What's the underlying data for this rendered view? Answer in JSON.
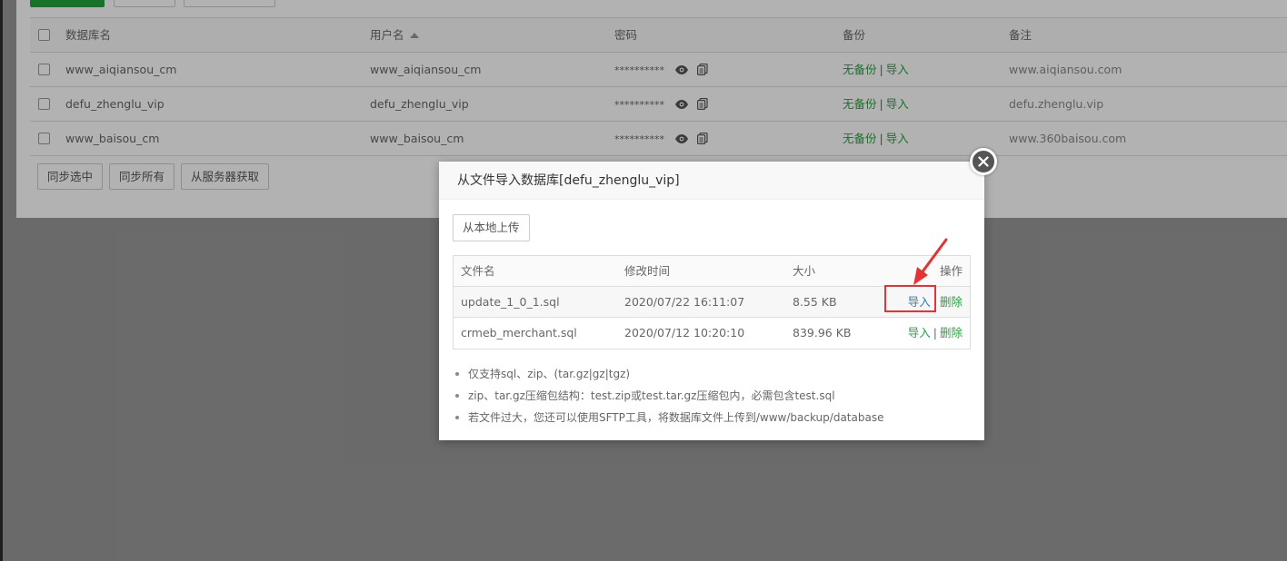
{
  "db_table": {
    "headers": {
      "name": "数据库名",
      "user": "用户名",
      "password": "密码",
      "backup": "备份",
      "note": "备注"
    },
    "rows": [
      {
        "name": "www_aiqiansou_cm",
        "user": "www_aiqiansou_cm",
        "password": "**********",
        "backup": "无备份",
        "import": "导入",
        "note": "www.aiqiansou.com"
      },
      {
        "name": "defu_zhenglu_vip",
        "user": "defu_zhenglu_vip",
        "password": "**********",
        "backup": "无备份",
        "import": "导入",
        "note": "defu.zhenglu.vip"
      },
      {
        "name": "www_baisou_cm",
        "user": "www_baisou_cm",
        "password": "**********",
        "backup": "无备份",
        "import": "导入",
        "note": "www.360baisou.com"
      }
    ],
    "separator": "|"
  },
  "bottom_buttons": {
    "sync_selected": "同步选中",
    "sync_all": "同步所有",
    "fetch_from_server": "从服务器获取"
  },
  "modal": {
    "title": "从文件导入数据库[defu_zhenglu_vip]",
    "upload_label": "从本地上传",
    "headers": {
      "filename": "文件名",
      "modified": "修改时间",
      "size": "大小",
      "actions": "操作"
    },
    "files": [
      {
        "filename": "update_1_0_1.sql",
        "modified": "2020/07/22 16:11:07",
        "size": "8.55 KB",
        "import": "导入",
        "delete": "删除"
      },
      {
        "filename": "crmeb_merchant.sql",
        "modified": "2020/07/12 10:20:10",
        "size": "839.96 KB",
        "import": "导入",
        "delete": "删除"
      }
    ],
    "separator": "|",
    "tips": [
      "仅支持sql、zip、(tar.gz|gz|tgz)",
      "zip、tar.gz压缩包结构：test.zip或test.tar.gz压缩包内，必需包含test.sql",
      "若文件过大，您还可以使用SFTP工具，将数据库文件上传到/www/backup/database"
    ]
  },
  "colors": {
    "accent_green": "#20a53a",
    "highlight_red": "#e53333",
    "link_blue": "#337ab7"
  }
}
